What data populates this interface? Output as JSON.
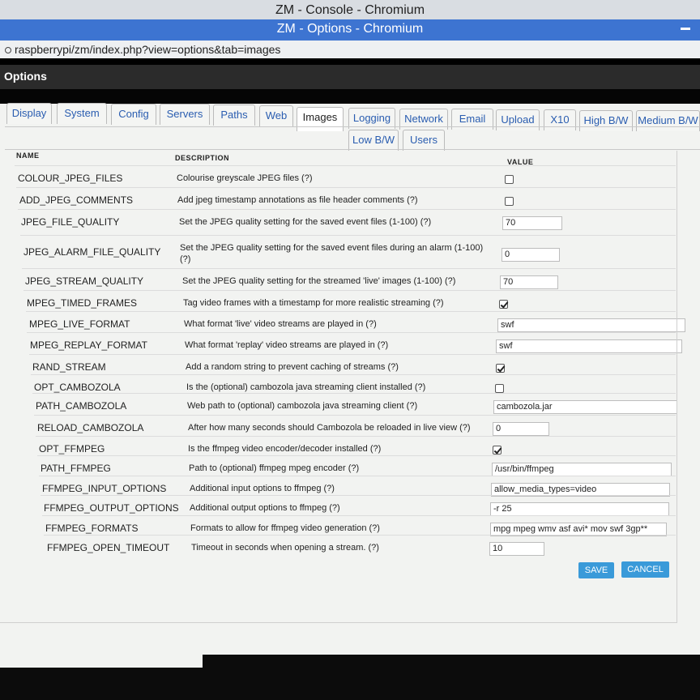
{
  "window": {
    "back_title": "ZM - Console - Chromium",
    "front_title": "ZM - Options - Chromium",
    "url": "raspberrypi/zm/index.php?view=options&tab=images"
  },
  "header": {
    "title": "Options"
  },
  "tabs": [
    {
      "label": "Display",
      "active": false
    },
    {
      "label": "System",
      "active": false
    },
    {
      "label": "Config",
      "active": false
    },
    {
      "label": "Servers",
      "active": false
    },
    {
      "label": "Paths",
      "active": false
    },
    {
      "label": "Web",
      "active": false
    },
    {
      "label": "Images",
      "active": true
    },
    {
      "label": "Logging",
      "active": false
    },
    {
      "label": "Network",
      "active": false
    },
    {
      "label": "Email",
      "active": false
    },
    {
      "label": "Upload",
      "active": false
    },
    {
      "label": "X10",
      "active": false
    },
    {
      "label": "High B/W",
      "active": false
    },
    {
      "label": "Medium B/W",
      "active": false
    },
    {
      "label": "Low B/W",
      "active": false
    },
    {
      "label": "Users",
      "active": false
    }
  ],
  "table": {
    "col_name": "NAME",
    "col_desc": "DESCRIPTION",
    "col_value": "VALUE",
    "rows": [
      {
        "name": "COLOUR_JPEG_FILES",
        "desc": "Colourise greyscale JPEG files (?)",
        "type": "checkbox",
        "checked": false
      },
      {
        "name": "ADD_JPEG_COMMENTS",
        "desc": "Add jpeg timestamp annotations as file header comments (?)",
        "type": "checkbox",
        "checked": false
      },
      {
        "name": "JPEG_FILE_QUALITY",
        "desc": "Set the JPEG quality setting for the saved event files (1-100) (?)",
        "type": "text",
        "value": "70"
      },
      {
        "name": "JPEG_ALARM_FILE_QUALITY",
        "desc": "Set the JPEG quality setting for the saved event files during an alarm (1-100) (?)",
        "type": "text",
        "value": "0"
      },
      {
        "name": "JPEG_STREAM_QUALITY",
        "desc": "Set the JPEG quality setting for the streamed 'live' images (1-100) (?)",
        "type": "text",
        "value": "70"
      },
      {
        "name": "MPEG_TIMED_FRAMES",
        "desc": "Tag video frames with a timestamp for more realistic streaming (?)",
        "type": "checkbox",
        "checked": true
      },
      {
        "name": "MPEG_LIVE_FORMAT",
        "desc": "What format 'live' video streams are played in (?)",
        "type": "text",
        "value": "swf"
      },
      {
        "name": "MPEG_REPLAY_FORMAT",
        "desc": "What format 'replay' video streams are played in (?)",
        "type": "text",
        "value": "swf"
      },
      {
        "name": "RAND_STREAM",
        "desc": "Add a random string to prevent caching of streams (?)",
        "type": "checkbox",
        "checked": true
      },
      {
        "name": "OPT_CAMBOZOLA",
        "desc": "Is the (optional) cambozola java streaming client installed (?)",
        "type": "checkbox",
        "checked": false
      },
      {
        "name": "PATH_CAMBOZOLA",
        "desc": "Web path to (optional) cambozola java streaming client (?)",
        "type": "text",
        "value": "cambozola.jar"
      },
      {
        "name": "RELOAD_CAMBOZOLA",
        "desc": "After how many seconds should Cambozola be reloaded in live view (?)",
        "type": "text",
        "value": "0"
      },
      {
        "name": "OPT_FFMPEG",
        "desc": "Is the ffmpeg video encoder/decoder installed (?)",
        "type": "checkbox",
        "checked": true
      },
      {
        "name": "PATH_FFMPEG",
        "desc": "Path to (optional) ffmpeg mpeg encoder (?)",
        "type": "text",
        "value": "/usr/bin/ffmpeg"
      },
      {
        "name": "FFMPEG_INPUT_OPTIONS",
        "desc": "Additional input options to ffmpeg (?)",
        "type": "text",
        "value": "allow_media_types=video"
      },
      {
        "name": "FFMPEG_OUTPUT_OPTIONS",
        "desc": "Additional output options to ffmpeg (?)",
        "type": "text",
        "value": "-r 25"
      },
      {
        "name": "FFMPEG_FORMATS",
        "desc": "Formats to allow for ffmpeg video generation (?)",
        "type": "text",
        "value": "mpg mpeg wmv asf avi* mov swf 3gp**"
      },
      {
        "name": "FFMPEG_OPEN_TIMEOUT",
        "desc": "Timeout in seconds when opening a stream. (?)",
        "type": "text",
        "value": "10"
      }
    ]
  },
  "buttons": {
    "save": "SAVE",
    "cancel": "CANCEL"
  },
  "colors": {
    "accent": "#3a9ad9",
    "titlebar": "#3d74d1",
    "link": "#2a5db0"
  }
}
